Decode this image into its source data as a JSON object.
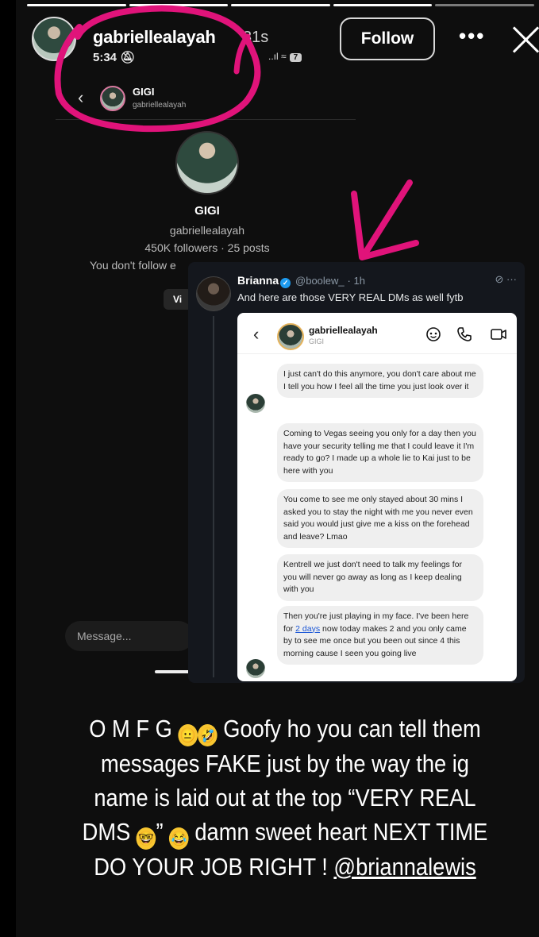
{
  "story": {
    "username": "gabriellealayah",
    "time_ago": "31s",
    "follow_label": "Follow",
    "more_label": "•••"
  },
  "inner_screenshot": {
    "status_time": "5:34",
    "status_icons": "..ıl  ≈",
    "battery": "7",
    "chat_name": "GIGI",
    "chat_handle": "gabriellealayah",
    "profile_name": "GIGI",
    "profile_handle": "gabriellealayah",
    "profile_stats": "450K followers · 25 posts",
    "profile_follow_note": "You don't follow e",
    "view_button": "Vi",
    "message_placeholder": "Message..."
  },
  "tweet": {
    "author_name": "Brianna",
    "author_handle": "@boolew_",
    "time": "· 1h",
    "actions": "⊘  ···",
    "text": "And here are those VERY REAL DMs as well fytb",
    "dm": {
      "name": "gabriellealayah",
      "sub": "GIGI",
      "messages": [
        "I just can't do this anymore, you don't care about me I tell you how I feel all the time you just look over it",
        "Coming to Vegas seeing you only for a day then you have your security telling me that I could leave it I'm ready to go? I made up a whole lie to Kai just to be here with you",
        "You come to see me only stayed about 30 mins I asked you to stay the night with me you never even said you would just give me a kiss on the forehead and leave? Lmao",
        "Kentrell we just don't need to talk my feelings for you will never go away as long as I keep dealing with you"
      ],
      "last_message_before": "Then you're just playing in my face. I've been here for ",
      "last_message_link": "2 days",
      "last_message_after": " now today makes 2 and you only came by to see me once but you been out since 4 this morning cause I seen you going live"
    }
  },
  "caption": {
    "part1": "O M F G ",
    "emoji1": "😐",
    "emoji2": "🤣",
    "part2": " Goofy ho you can tell them messages FAKE  just by the way the ig name is laid out at the top “VERY REAL DMS ",
    "emoji3": "🤓",
    "part3": "” ",
    "emoji4": "😂",
    "part4": " damn sweet heart  NEXT TIME DO YOUR JOB RIGHT ! ",
    "mention": "@briannalewis"
  },
  "colors": {
    "annotation": "#e0137a",
    "tweet_bg": "#14171d",
    "verified": "#1d9bf0",
    "link": "#1a56d6"
  }
}
